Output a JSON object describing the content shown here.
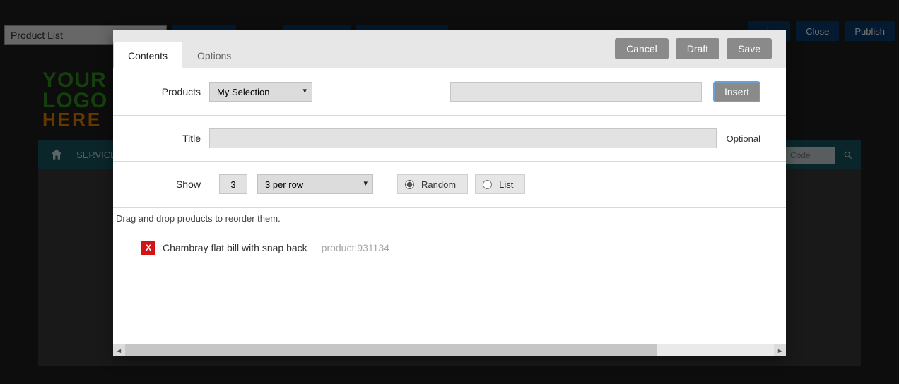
{
  "page": {
    "title_input": "Product List",
    "top_right_buttons": {
      "view": "…iew",
      "close": "Close",
      "publish": "Publish"
    }
  },
  "bg": {
    "nav_item1": "SERVICE",
    "search_placeholder": "Code",
    "logo_line1": "YOUR",
    "logo_line2": "LOGO",
    "logo_line3": "HERE"
  },
  "modal": {
    "tabs": {
      "contents": "Contents",
      "options": "Options"
    },
    "actions": {
      "cancel": "Cancel",
      "draft": "Draft",
      "save": "Save"
    },
    "products": {
      "label": "Products",
      "selected": "My Selection",
      "insert": "Insert"
    },
    "title_row": {
      "label": "Title",
      "value": "",
      "optional": "Optional"
    },
    "show_row": {
      "label": "Show",
      "count": "3",
      "per_row": "3 per row",
      "random": "Random",
      "list": "List",
      "radio_selected": "random"
    },
    "reorder_hint": "Drag and drop products to reorder them.",
    "items": [
      {
        "name": "Chambray flat bill with snap back",
        "id_label": "product:931134"
      }
    ]
  }
}
